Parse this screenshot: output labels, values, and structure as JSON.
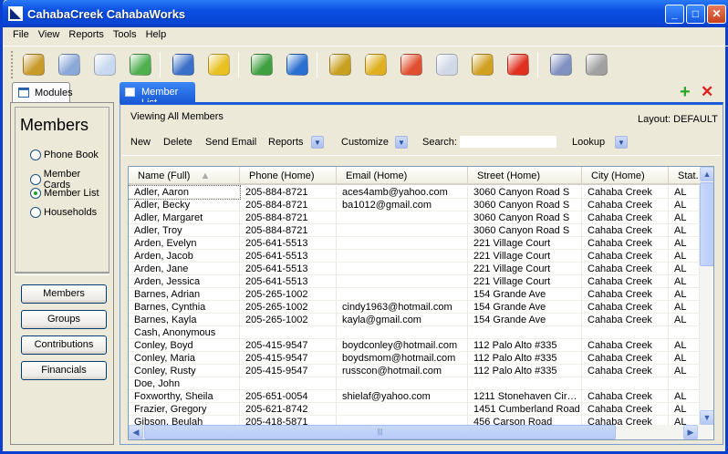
{
  "window": {
    "title": "CahabaCreek CahabaWorks",
    "controls": [
      "_",
      "□",
      "✕"
    ]
  },
  "menu": [
    "File",
    "View",
    "Reports",
    "Tools",
    "Help"
  ],
  "toolbar": [
    "address-book-icon",
    "news-icon",
    "document-icon",
    "family-group-icon",
    "couple-icon",
    "footprints-icon",
    "envelope-money-icon",
    "mailbox-icon",
    "coins-money-icon",
    "gift-box-icon",
    "credit-card-icon",
    "calendar-grid-icon",
    "gift-arrow-icon",
    "alarm-clock-icon",
    "users-icon",
    "theater-masks-icon"
  ],
  "modules": {
    "tab": "Modules",
    "heading": "Members",
    "options": [
      {
        "label": "Phone Book",
        "selected": false
      },
      {
        "label": "Member Cards",
        "selected": false
      },
      {
        "label": "Member List",
        "selected": true
      },
      {
        "label": "Households",
        "selected": false
      }
    ],
    "nav": [
      "Members",
      "Groups",
      "Contributions",
      "Financials"
    ]
  },
  "main": {
    "tab": "Member List",
    "viewing": "Viewing All Members",
    "layout": "Layout: DEFAULT",
    "actions": {
      "new": "New",
      "delete": "Delete",
      "send_email": "Send Email",
      "reports": "Reports",
      "customize": "Customize",
      "search": "Search:",
      "search_value": "",
      "lookup": "Lookup"
    },
    "columns": [
      "Name (Full)",
      "Phone (Home)",
      "Email (Home)",
      "Street (Home)",
      "City (Home)",
      "Stat."
    ],
    "sort": {
      "column": "Name (Full)",
      "direction": "ascending"
    },
    "rows": [
      [
        "Adler, Aaron",
        "205-884-8721",
        "aces4amb@yahoo.com",
        "3060 Canyon Road S",
        "Cahaba Creek",
        "AL"
      ],
      [
        "Adler, Becky",
        "205-884-8721",
        "ba1012@gmail.com",
        "3060 Canyon Road S",
        "Cahaba Creek",
        "AL"
      ],
      [
        "Adler, Margaret",
        "205-884-8721",
        "",
        "3060 Canyon Road S",
        "Cahaba Creek",
        "AL"
      ],
      [
        "Adler, Troy",
        "205-884-8721",
        "",
        "3060 Canyon Road S",
        "Cahaba Creek",
        "AL"
      ],
      [
        "Arden, Evelyn",
        "205-641-5513",
        "",
        "221 Village Court",
        "Cahaba Creek",
        "AL"
      ],
      [
        "Arden, Jacob",
        "205-641-5513",
        "",
        "221 Village Court",
        "Cahaba Creek",
        "AL"
      ],
      [
        "Arden, Jane",
        "205-641-5513",
        "",
        "221 Village Court",
        "Cahaba Creek",
        "AL"
      ],
      [
        "Arden, Jessica",
        "205-641-5513",
        "",
        "221 Village Court",
        "Cahaba Creek",
        "AL"
      ],
      [
        "Barnes, Adrian",
        "205-265-1002",
        "",
        "154 Grande Ave",
        "Cahaba Creek",
        "AL"
      ],
      [
        "Barnes, Cynthia",
        "205-265-1002",
        "cindy1963@hotmail.com",
        "154 Grande Ave",
        "Cahaba Creek",
        "AL"
      ],
      [
        "Barnes, Kayla",
        "205-265-1002",
        "kayla@gmail.com",
        "154 Grande Ave",
        "Cahaba Creek",
        "AL"
      ],
      [
        "Cash, Anonymous",
        "",
        "",
        "",
        "",
        ""
      ],
      [
        "Conley, Boyd",
        "205-415-9547",
        "boydconley@hotmail.com",
        "112 Palo Alto #335",
        "Cahaba Creek",
        "AL"
      ],
      [
        "Conley, Maria",
        "205-415-9547",
        "boydsmom@hotmail.com",
        "112 Palo Alto #335",
        "Cahaba Creek",
        "AL"
      ],
      [
        "Conley, Rusty",
        "205-415-9547",
        "russcon@hotmail.com",
        "112 Palo Alto #335",
        "Cahaba Creek",
        "AL"
      ],
      [
        "Doe, John",
        "",
        "",
        "",
        "",
        ""
      ],
      [
        "Foxworthy, Sheila",
        "205-651-0054",
        "shielaf@yahoo.com",
        "1211 Stonehaven Cir…",
        "Cahaba Creek",
        "AL"
      ],
      [
        "Frazier, Gregory",
        "205-621-8742",
        "",
        "1451 Cumberland Road",
        "Cahaba Creek",
        "AL"
      ],
      [
        "Gibson, Beulah",
        "205-418-5871",
        "",
        "456 Carson Road",
        "Cahaba Creek",
        "AL"
      ]
    ]
  }
}
